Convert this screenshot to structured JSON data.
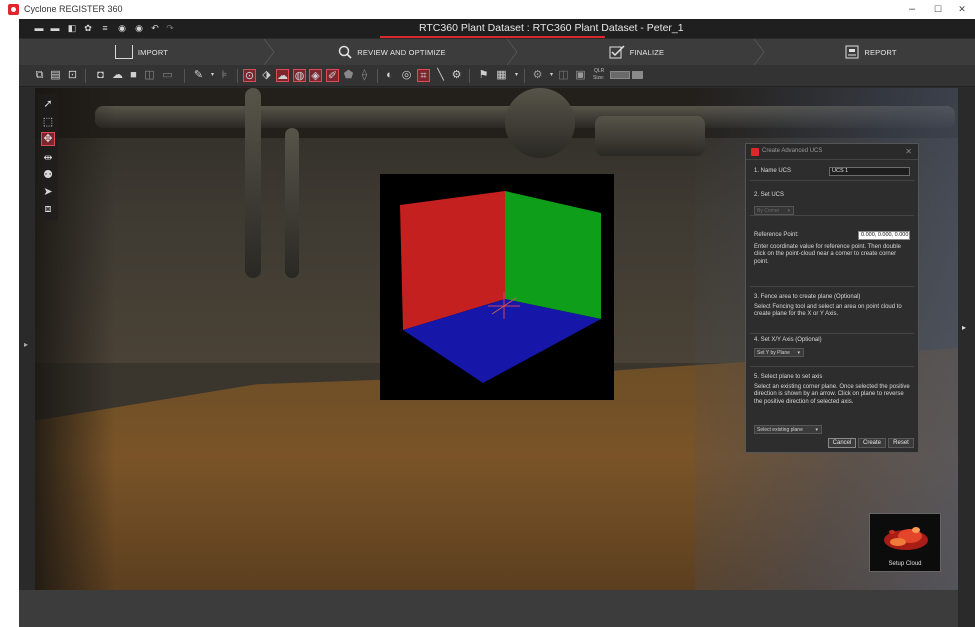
{
  "window": {
    "app_title": "Cyclone REGISTER 360",
    "document_title": "RTC360 Plant Dataset : RTC360 Plant Dataset - Peter_1",
    "minimize": "–",
    "maximize": "☐",
    "close": "✕"
  },
  "workflow_tabs": [
    {
      "label": "IMPORT",
      "icon": "import-icon"
    },
    {
      "label": "REVIEW AND OPTIMIZE",
      "icon": "search-icon",
      "active": true
    },
    {
      "label": "FINALIZE",
      "icon": "checkbox-icon"
    },
    {
      "label": "REPORT",
      "icon": "report-icon"
    }
  ],
  "toolbar": {
    "qlr_label": "QLR",
    "size_label": "Size:",
    "highlighted_tools": [
      "ucs-tool",
      "fence-tool",
      "cloud-tool",
      "sphere-tool",
      "brush-tool",
      "limitbox-tool"
    ]
  },
  "dialog": {
    "title": "Create Advanced UCS",
    "close": "✕",
    "step1_label": "1. Name UCS",
    "step1_value": "UCS 1",
    "step2_label": "2. Set UCS",
    "step2_combo": "By Corner",
    "ref_point_label": "Reference Point:",
    "ref_point_value": "0.000, 0.000, 0.000",
    "ref_point_help": "Enter coordinate value for reference point. Then double click on the point-cloud near a corner to create corner point.",
    "step3_label": "3. Fence area to create plane (Optional)",
    "step3_help": "Select Fencing tool and select an area on point cloud to create plane for the X or Y Axis.",
    "step4_label": "4. Set X/Y Axis (Optional)",
    "step4_combo": "Set Y by Plane",
    "step5_label": "5. Select plane to set axis",
    "step5_help": "Select an existing corner plane. Once selected the positive direction is shown by an arrow. Click on plane to reverse the positive direction of selected axis.",
    "step5_combo": "Select existing plane",
    "cancel_button": "Cancel",
    "create_button": "Create",
    "reset_button": "Reset"
  },
  "setup_cloud": {
    "label": "Setup Cloud"
  },
  "colors": {
    "accent_red": "#d9272e",
    "cube_red": "#c42020",
    "cube_green": "#0f9e1a",
    "cube_blue": "#1616a8"
  }
}
